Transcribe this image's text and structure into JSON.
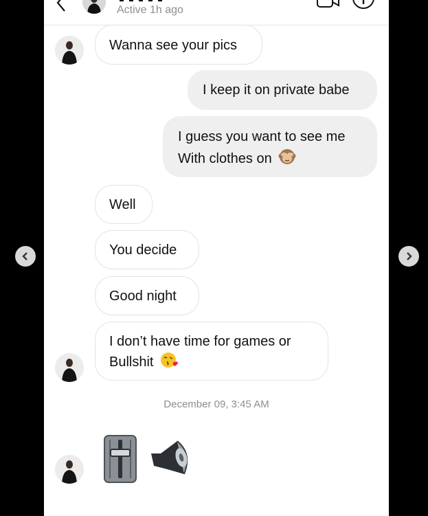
{
  "header": {
    "status": "Active 1h ago"
  },
  "messages": [
    {
      "direction": "in",
      "text": "Wanna see your pics"
    },
    {
      "direction": "out",
      "text": "I keep it on private babe"
    },
    {
      "direction": "out",
      "lines": [
        "I guess you want to see me",
        "With clothes on"
      ],
      "emoji": "see-no-evil-monkey"
    },
    {
      "direction": "in",
      "text": "Well"
    },
    {
      "direction": "in",
      "text": "You decide"
    },
    {
      "direction": "in",
      "text": "Good night"
    },
    {
      "direction": "in",
      "lines": [
        "I don’t have time for games or",
        "Bullshit"
      ],
      "emoji": "kissing-face-with-heart"
    }
  ],
  "timestamp": "December 09, 3:45 AM",
  "stickers": [
    "slider-control-emoji",
    "speaker-emoji"
  ],
  "colors": {
    "outgoing_bubble": "#efefef",
    "incoming_border": "#e3e3e3",
    "muted_text": "#8e8e8e"
  },
  "icons": {
    "back": "chevron-left-icon",
    "video": "video-camera-icon",
    "info": "info-icon",
    "prev": "chevron-left-icon",
    "next": "chevron-right-icon"
  }
}
